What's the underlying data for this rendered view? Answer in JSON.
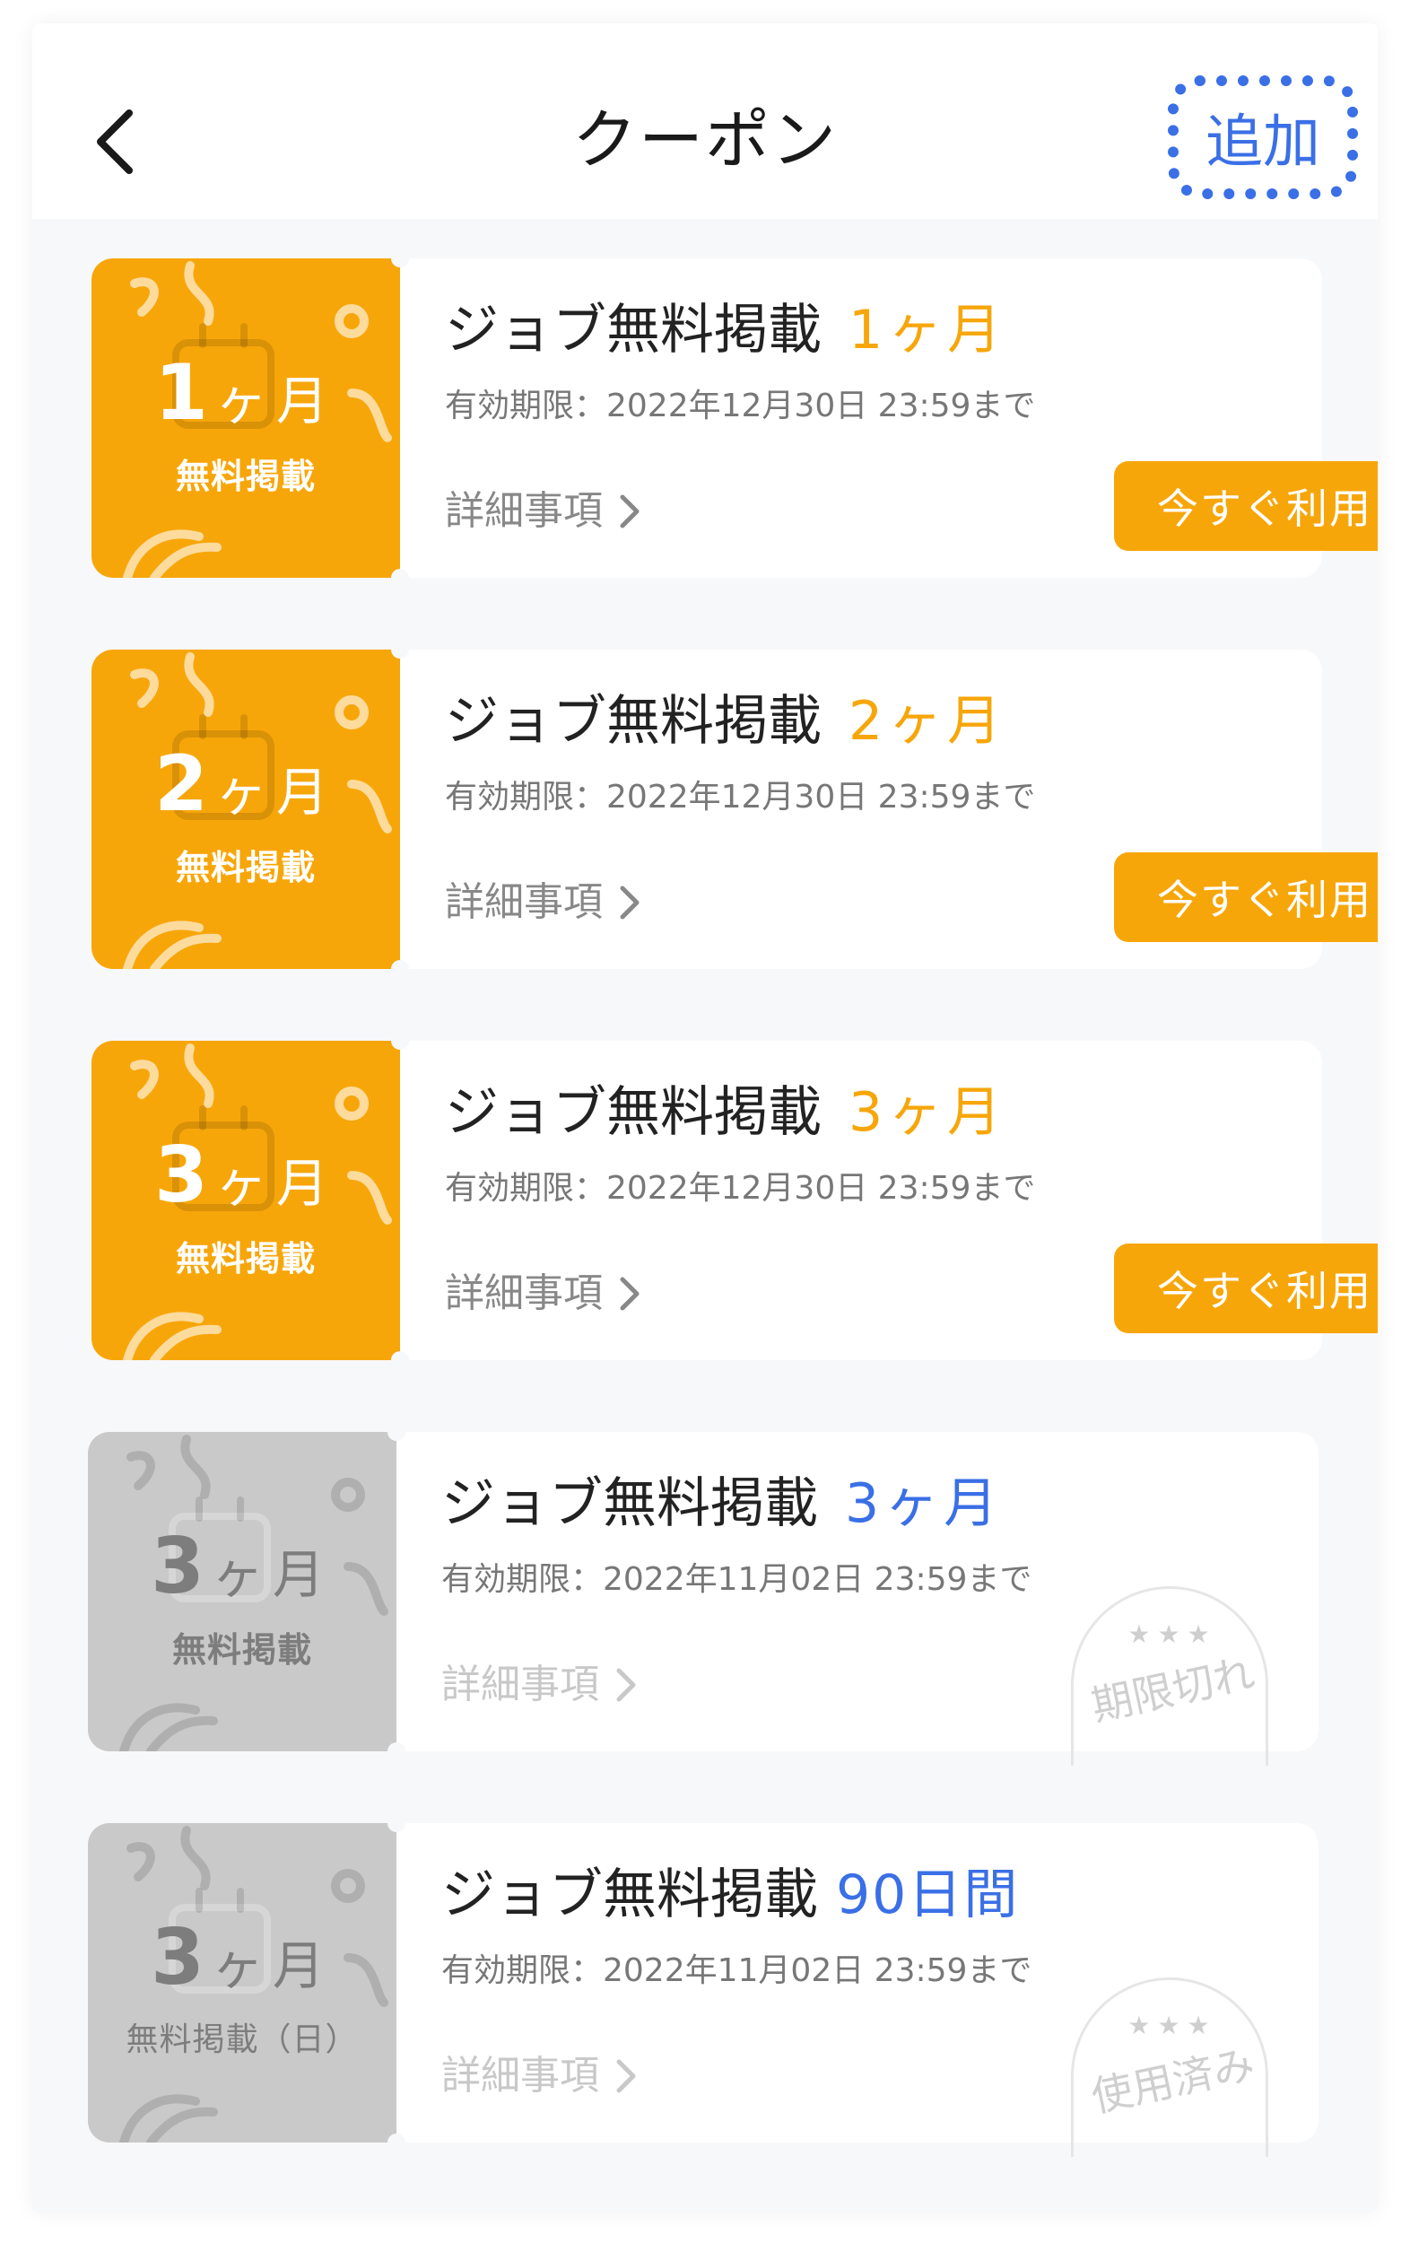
{
  "header": {
    "title": "クーポン",
    "add_label": "追加",
    "accent_color": "#3a6fe6"
  },
  "common": {
    "details_label": "詳細事項",
    "use_label": "今すぐ利用",
    "coupon_name": "ジョブ無料掲載",
    "unit": "ヶ月"
  },
  "coupons": [
    {
      "status": "active",
      "ticket_number": "1",
      "ticket_unit": "ヶ月",
      "ticket_label": "無料掲載",
      "title": "ジョブ無料掲載",
      "duration": "1ヶ月",
      "expiry": "有効期限：2022年12月30日 23:59まで",
      "details": "詳細事項",
      "button": "今すぐ利用"
    },
    {
      "status": "active",
      "ticket_number": "2",
      "ticket_unit": "ヶ月",
      "ticket_label": "無料掲載",
      "title": "ジョブ無料掲載",
      "duration": "2ヶ月",
      "expiry": "有効期限：2022年12月30日 23:59まで",
      "details": "詳細事項",
      "button": "今すぐ利用"
    },
    {
      "status": "active",
      "ticket_number": "3",
      "ticket_unit": "ヶ月",
      "ticket_label": "無料掲載",
      "title": "ジョブ無料掲載",
      "duration": "3ヶ月",
      "expiry": "有効期限：2022年12月30日 23:59まで",
      "details": "詳細事項",
      "button": "今すぐ利用"
    },
    {
      "status": "expired",
      "ticket_number": "3",
      "ticket_unit": "ヶ月",
      "ticket_label": "無料掲載",
      "title": "ジョブ無料掲載",
      "duration": "3ヶ月",
      "expiry": "有効期限：2022年11月02日 23:59まで",
      "details": "詳細事項",
      "stamp": "期限切れ"
    },
    {
      "status": "used",
      "ticket_number": "3",
      "ticket_unit": "ヶ月",
      "ticket_label": "無料掲載（日）",
      "title": "ジョブ無料掲載",
      "duration": "90日間",
      "expiry": "有効期限：2022年11月02日 23:59まで",
      "details": "詳細事項",
      "stamp": "使用済み"
    }
  ],
  "colors": {
    "active": "#f7a60a",
    "inactive": "#c9c9c9",
    "blue": "#3a6fe6"
  }
}
